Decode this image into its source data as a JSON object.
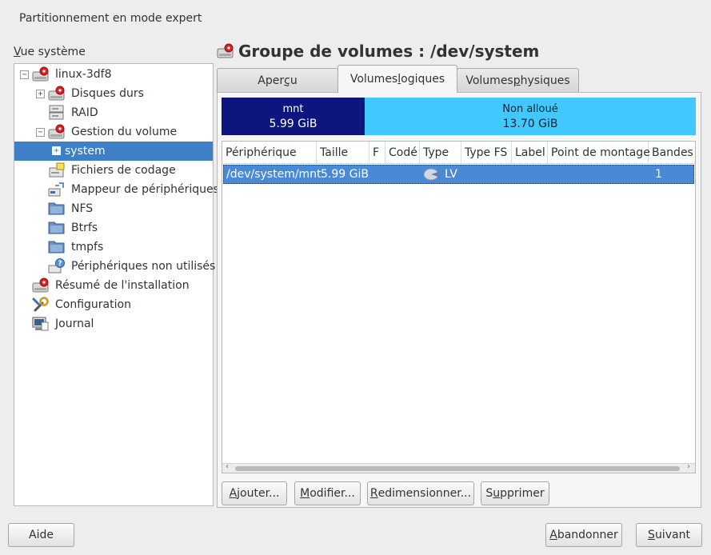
{
  "window": {
    "title": "Partitionnement en mode expert"
  },
  "system_view": {
    "label_ul": "V",
    "label_rest": "ue système",
    "tree": [
      {
        "label": "linux-3df8",
        "expander": "⊟",
        "icon": "hard-disk-icon"
      },
      {
        "label": "Disques durs",
        "expander": "⊞",
        "icon": "hard-disk-icon"
      },
      {
        "label": "RAID",
        "icon": "raid-icon"
      },
      {
        "label": "Gestion du volume",
        "expander": "⊟",
        "icon": "volume-management-icon"
      },
      {
        "label": "system",
        "expander": "⊞",
        "selected": true
      },
      {
        "label": "Fichiers de codage",
        "icon": "crypt-files-icon"
      },
      {
        "label": "Mappeur de périphériques",
        "icon": "device-mapper-icon"
      },
      {
        "label": "NFS",
        "icon": "nfs-folder-icon"
      },
      {
        "label": "Btrfs",
        "icon": "btrfs-folder-icon"
      },
      {
        "label": "tmpfs",
        "icon": "tmpfs-folder-icon"
      },
      {
        "label": "Périphériques non utilisés",
        "icon": "unused-devices-icon"
      },
      {
        "label": "Résumé de l'installation",
        "icon": "installation-summary-icon"
      },
      {
        "label": "Configuration",
        "icon": "configuration-icon"
      },
      {
        "label": "Journal",
        "icon": "journal-icon"
      }
    ]
  },
  "volume_group": {
    "title": "Groupe de volumes : /dev/system",
    "tabs": [
      {
        "pre": "Aper",
        "ul": "ç",
        "post": "u"
      },
      {
        "pre": "Volumes ",
        "ul": "l",
        "post": "ogiques"
      },
      {
        "pre": "Volumes ",
        "ul": "p",
        "post": "hysiques"
      }
    ],
    "active_tab": 1
  },
  "usage_bar": {
    "segments": [
      {
        "name": "mnt",
        "size": "5.99 GiB",
        "color": "#0c167e"
      },
      {
        "name": "Non alloué",
        "size": "13.70 GiB",
        "color": "#40c8ff"
      }
    ]
  },
  "lv_table": {
    "columns": [
      "Périphérique",
      "Taille",
      "F",
      "Codé",
      "Type",
      "Type FS",
      "Label",
      "Point de montage",
      "Bandes"
    ],
    "rows": [
      {
        "device": "/dev/system/mnt",
        "size": "5.99 GiB",
        "f": "",
        "encrypted": "",
        "type": "LV",
        "type_icon": "lv-icon",
        "fs_type": "",
        "label": "",
        "mount_point": "",
        "stripes": "1"
      }
    ]
  },
  "actions": {
    "add": {
      "ul": "A",
      "rest": "jouter..."
    },
    "edit": {
      "ul": "M",
      "rest": "odifier..."
    },
    "resize": {
      "ul": "R",
      "rest": "edimensionner..."
    },
    "delete": {
      "pre": "S",
      "ul": "u",
      "rest": "pprimer"
    }
  },
  "footer": {
    "help": "Aide",
    "abort": {
      "ul": "A",
      "rest": "bandonner"
    },
    "next": {
      "ul": "S",
      "rest": "uivant"
    }
  }
}
